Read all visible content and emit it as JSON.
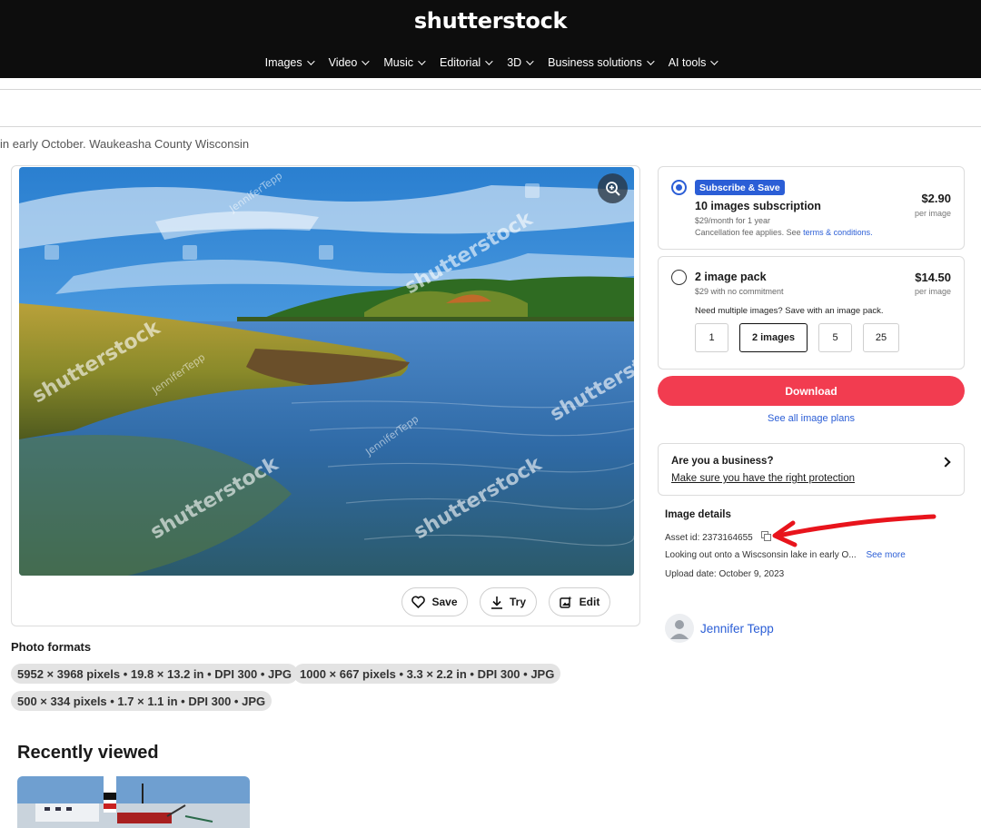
{
  "header": {
    "logo": "shutterstock",
    "nav": [
      {
        "label": "Images"
      },
      {
        "label": "Video"
      },
      {
        "label": "Music"
      },
      {
        "label": "Editorial"
      },
      {
        "label": "3D"
      },
      {
        "label": "Business solutions"
      },
      {
        "label": "AI tools"
      }
    ]
  },
  "page": {
    "title_fragment": "in early October. Waukeasha County Wisconsin"
  },
  "image_card": {
    "watermark": "shutterstock",
    "credit_watermark": "JenniferTepp",
    "actions": {
      "save": "Save",
      "try": "Try",
      "edit": "Edit"
    }
  },
  "formats": {
    "label": "Photo formats",
    "chips": [
      "5952 × 3968 pixels • 19.8 × 13.2 in • DPI 300 • JPG",
      "1000 × 667 pixels • 3.3 × 2.2 in • DPI 300 • JPG",
      "500 × 334 pixels • 1.7 × 1.1 in • DPI 300 • JPG"
    ]
  },
  "recent": {
    "title": "Recently viewed"
  },
  "plans": {
    "subscription": {
      "badge": "Subscribe & Save",
      "title": "10 images subscription",
      "sub1": "$29/month for 1 year",
      "sub2_prefix": "Cancellation fee applies. See ",
      "sub2_link": "terms & conditions.",
      "price": "$2.90",
      "per": "per image",
      "selected": true
    },
    "pack": {
      "title": "2 image pack",
      "sub": "$29 with no commitment",
      "price": "$14.50",
      "per": "per image",
      "prompt": "Need multiple images? Save with an image pack.",
      "quantities": [
        "1",
        "2 images",
        "5",
        "25"
      ],
      "selected_quantity": "2 images"
    },
    "download": "Download",
    "see_all": "See all image plans"
  },
  "business": {
    "question": "Are you a business?",
    "link": "Make sure you have the right protection"
  },
  "details": {
    "title": "Image details",
    "asset_id": "Asset id: 2373164655",
    "description": "Looking out onto a Wiscsonsin lake in early O...",
    "see_more": "See more",
    "upload_date": "Upload date: October 9, 2023"
  },
  "author": {
    "name": "Jennifer Tepp"
  },
  "colors": {
    "accent_blue": "#2b5ed6",
    "download_red": "#f23c50",
    "header_bg": "#0d0d0d",
    "annotation_red": "#e8141c"
  }
}
